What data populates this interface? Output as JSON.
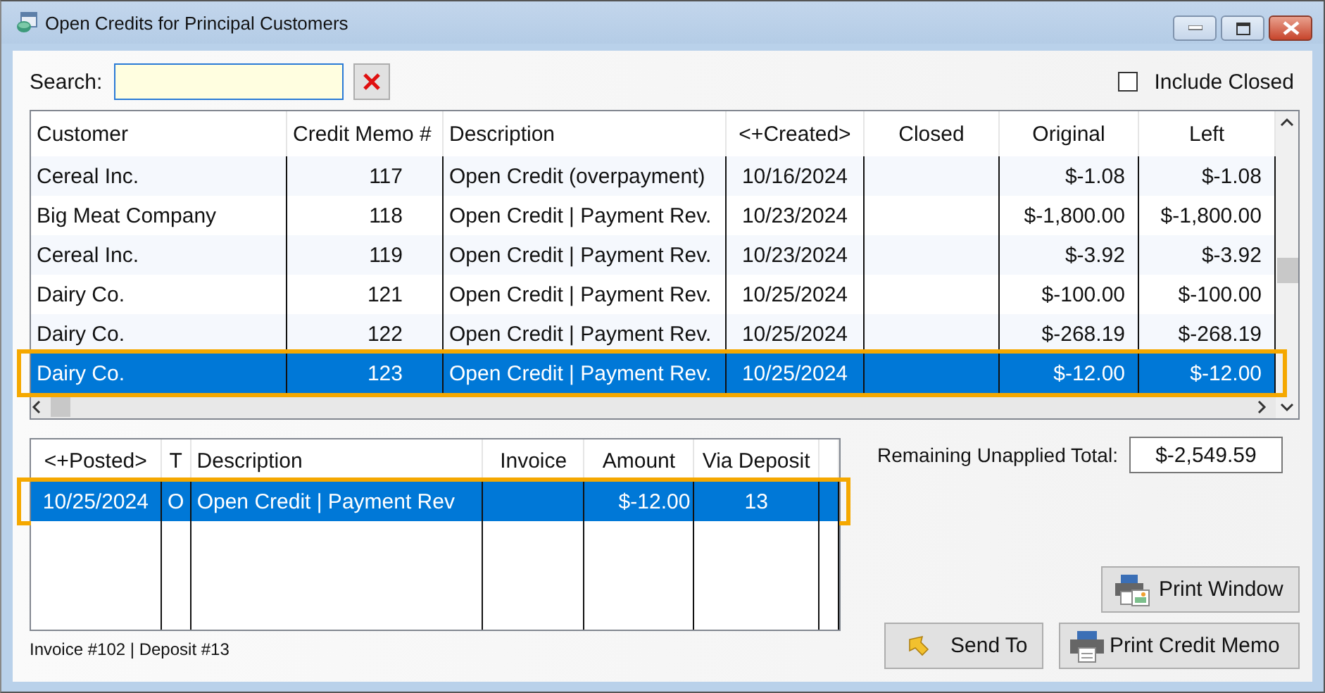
{
  "window": {
    "title": "Open Credits for Principal Customers"
  },
  "search": {
    "label": "Search:"
  },
  "include_closed": {
    "label": "Include Closed",
    "checked": false
  },
  "credits_table": {
    "columns": [
      "Customer",
      "Credit Memo #",
      "Description",
      "<+Created>",
      "Closed",
      "Original",
      "Left"
    ],
    "rows": [
      {
        "cells": [
          "Cereal Inc.",
          "117",
          "Open Credit (overpayment)",
          "10/16/2024",
          "",
          "$-1.08",
          "$-1.08"
        ],
        "selected": false,
        "highlighted": false
      },
      {
        "cells": [
          "Big Meat Company",
          "118",
          "Open Credit | Payment Rev.",
          "10/23/2024",
          "",
          "$-1,800.00",
          "$-1,800.00"
        ],
        "selected": false,
        "highlighted": false
      },
      {
        "cells": [
          "Cereal Inc.",
          "119",
          "Open Credit | Payment Rev.",
          "10/23/2024",
          "",
          "$-3.92",
          "$-3.92"
        ],
        "selected": false,
        "highlighted": false
      },
      {
        "cells": [
          "Dairy Co.",
          "121",
          "Open Credit | Payment Rev.",
          "10/25/2024",
          "",
          "$-100.00",
          "$-100.00"
        ],
        "selected": false,
        "highlighted": false
      },
      {
        "cells": [
          "Dairy Co.",
          "122",
          "Open Credit | Payment Rev.",
          "10/25/2024",
          "",
          "$-268.19",
          "$-268.19"
        ],
        "selected": false,
        "highlighted": false
      },
      {
        "cells": [
          "Dairy Co.",
          "123",
          "Open Credit | Payment Rev.",
          "10/25/2024",
          "",
          "$-12.00",
          "$-12.00"
        ],
        "selected": true,
        "highlighted": true
      }
    ]
  },
  "details_table": {
    "columns": [
      "<+Posted>",
      "T",
      "Description",
      "Invoice",
      "Amount",
      "Via Deposit"
    ],
    "rows": [
      {
        "cells": [
          "10/25/2024",
          "O",
          "Open Credit | Payment Rev",
          "",
          "$-12.00",
          "13"
        ],
        "selected": true,
        "highlighted": true
      }
    ]
  },
  "remaining": {
    "label": "Remaining Unapplied Total:",
    "value": "$-2,549.59"
  },
  "buttons": [
    {
      "label": "Print Window",
      "kind": "print-window"
    },
    {
      "label": "Send To",
      "kind": "send"
    },
    {
      "label": "Print Credit Memo",
      "kind": "print"
    }
  ],
  "status": "Invoice #102 | Deposit #13"
}
